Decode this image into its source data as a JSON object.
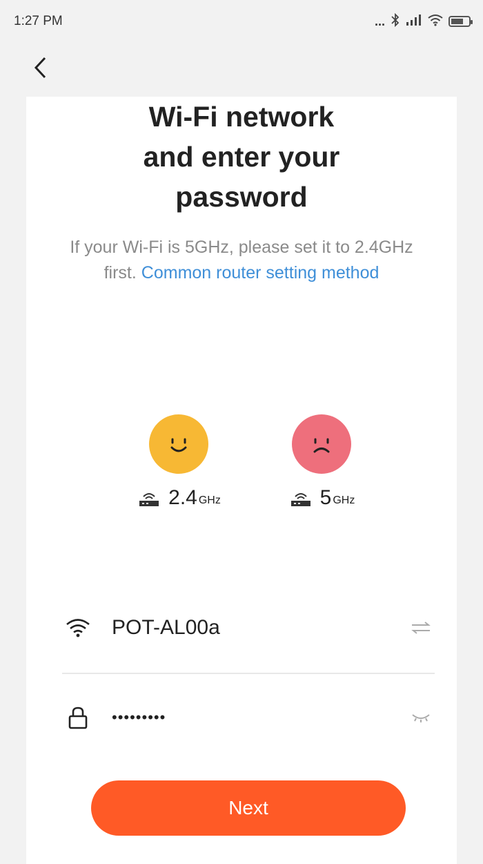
{
  "status_bar": {
    "time": "1:27 PM",
    "icons": [
      "more-dots-icon",
      "bluetooth-icon",
      "signal-icon",
      "wifi-icon",
      "battery-icon"
    ],
    "dots": "..."
  },
  "header": {
    "back_icon": "chevron-left-icon"
  },
  "title_lines": [
    "Wi-Fi network",
    "and enter your",
    "password"
  ],
  "subtitle": {
    "text": "If your Wi-Fi is 5GHz, please set it to 2.4GHz first.",
    "link": "Common router setting method"
  },
  "bands": [
    {
      "num": "2.4",
      "unit": "GHz",
      "face": "smile-icon",
      "color": "#f7b834"
    },
    {
      "num": "5",
      "unit": "GHz",
      "face": "frown-icon",
      "color": "#ee6f7c"
    }
  ],
  "fields": {
    "network": {
      "value": "POT-AL00a",
      "icon": "wifi-icon",
      "action_icon": "switch-network-icon"
    },
    "password": {
      "value": "•••••••••",
      "icon": "lock-icon",
      "action_icon": "eye-closed-icon"
    }
  },
  "next_label": "Next",
  "colors": {
    "accent": "#ff5a26",
    "link": "#3f8fd8"
  }
}
